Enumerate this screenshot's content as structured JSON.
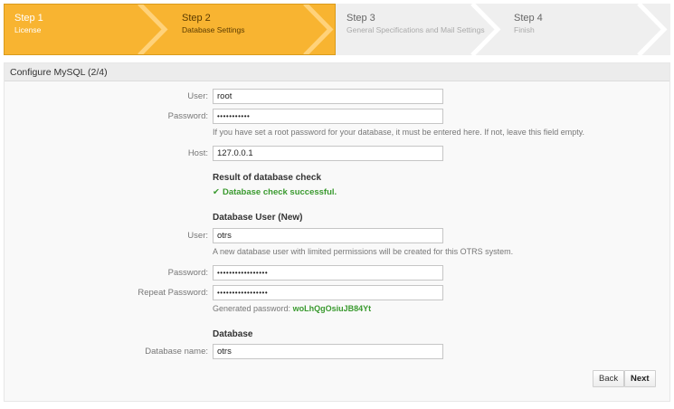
{
  "steps": [
    {
      "number": "Step 1",
      "title": "License"
    },
    {
      "number": "Step 2",
      "title": "Database Settings"
    },
    {
      "number": "Step 3",
      "title": "General Specifications and Mail Settings"
    },
    {
      "number": "Step 4",
      "title": "Finish"
    }
  ],
  "panel": {
    "title": "Configure MySQL (2/4)"
  },
  "form": {
    "user_label": "User:",
    "user_value": "root",
    "password_label": "Password:",
    "password_value": "•••••••••••",
    "password_hint": "If you have set a root password for your database, it must be entered here. If not, leave this field empty.",
    "host_label": "Host:",
    "host_value": "127.0.0.1",
    "check_heading": "Result of database check",
    "check_result": "Database check successful.",
    "db_user_heading": "Database User (New)",
    "db_user_label": "User:",
    "db_user_value": "otrs",
    "db_user_hint": "A new database user with limited permissions will be created for this OTRS system.",
    "db_password_label": "Password:",
    "db_password_value": "•••••••••••••••••",
    "repeat_password_label": "Repeat Password:",
    "repeat_password_value": "•••••••••••••••••",
    "generated_password_label": "Generated password:",
    "generated_password_value": "woLhQgOsiuJB84Yt",
    "database_heading": "Database",
    "db_name_label": "Database name:",
    "db_name_value": "otrs"
  },
  "buttons": {
    "back": "Back",
    "next": "Next"
  },
  "colors": {
    "step_active": "#f8b431",
    "step_inactive": "#efefef",
    "success": "#3a9a2f"
  }
}
